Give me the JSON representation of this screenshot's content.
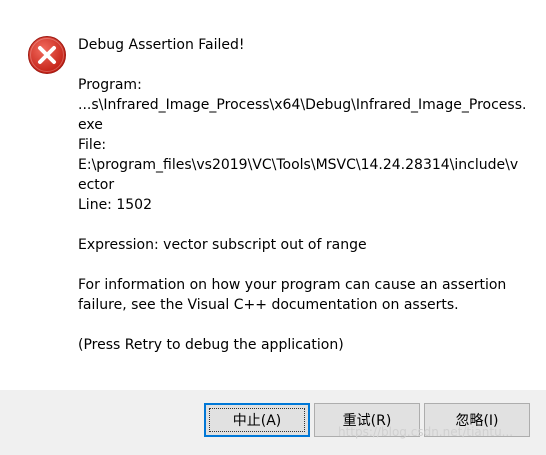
{
  "dialog": {
    "title": "Debug Assertion Failed!",
    "icon": "error-icon",
    "program_label": "Program:",
    "program_path_line1": "...s\\Infrared_Image_Process\\x64\\Debug\\Infrared_Image_Process.",
    "program_path_line2": "exe",
    "file_label": "File:",
    "file_path_line1": "E:\\program_files\\vs2019\\VC\\Tools\\MSVC\\14.24.28314\\include\\v",
    "file_path_line2": "ector",
    "line_text": "Line: 1502",
    "expression_text": "Expression: vector subscript out of range",
    "info_line1": "For information on how your program can cause an assertion",
    "info_line2": "failure, see the Visual C++ documentation on asserts.",
    "hint_text": "(Press Retry to debug the application)"
  },
  "buttons": {
    "abort_label": "中止(A)",
    "retry_label": "重试(R)",
    "ignore_label": "忽略(I)"
  },
  "watermark": "https://blog.csdn.net/tiantu...",
  "colors": {
    "error_red": "#d9352b",
    "footer_bg": "#f0f0f0",
    "focus_blue": "#0078d7"
  }
}
